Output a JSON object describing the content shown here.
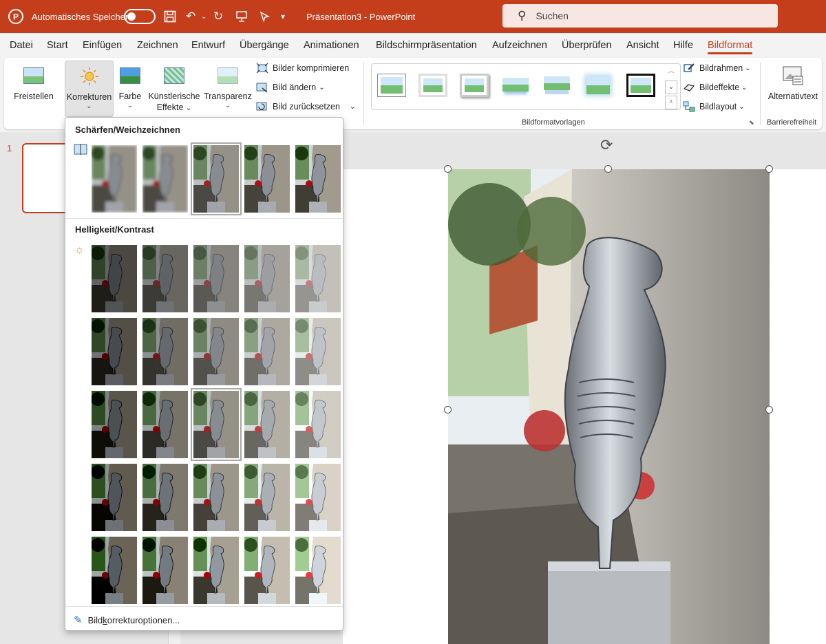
{
  "app": {
    "autosave_label": "Automatisches Speichern",
    "doc_title": "Präsentation3  -  PowerPoint",
    "search_placeholder": "Suchen",
    "brand_color": "#c43e1c"
  },
  "menu": {
    "tabs": [
      "Datei",
      "Start",
      "Einfügen",
      "Zeichnen",
      "Entwurf",
      "Übergänge",
      "Animationen",
      "Bildschirmpräsentation",
      "Aufzeichnen",
      "Überprüfen",
      "Ansicht",
      "Hilfe",
      "Bildformat"
    ],
    "active": "Bildformat"
  },
  "ribbon": {
    "freistellen": "Freistellen",
    "korrekturen": "Korrekturen",
    "farbe": "Farbe",
    "kuenstlerische_1": "Künstlerische",
    "kuenstlerische_2": "Effekte",
    "transparenz": "Transparenz",
    "komprimieren": "Bilder komprimieren",
    "aendern": "Bild ändern",
    "zuruecksetzen": "Bild zurücksetzen",
    "styles_group": "Bildformatvorlagen",
    "bildrahmen": "Bildrahmen",
    "bildeffekte": "Bildeffekte",
    "bildlayout": "Bildlayout",
    "alternativtext": "Alternativtext",
    "barrierefreiheit": "Barrierefreiheit"
  },
  "slides": {
    "number": "1"
  },
  "dropdown": {
    "section1": "Schärfen/Weichzeichnen",
    "section2": "Helligkeit/Kontrast",
    "options_pre": "Bild",
    "options_key": "k",
    "options_post": "orrekturoptionen...",
    "sharpen_selected_index": 2,
    "brightness_selected_row": 2,
    "brightness_selected_col": 2
  }
}
